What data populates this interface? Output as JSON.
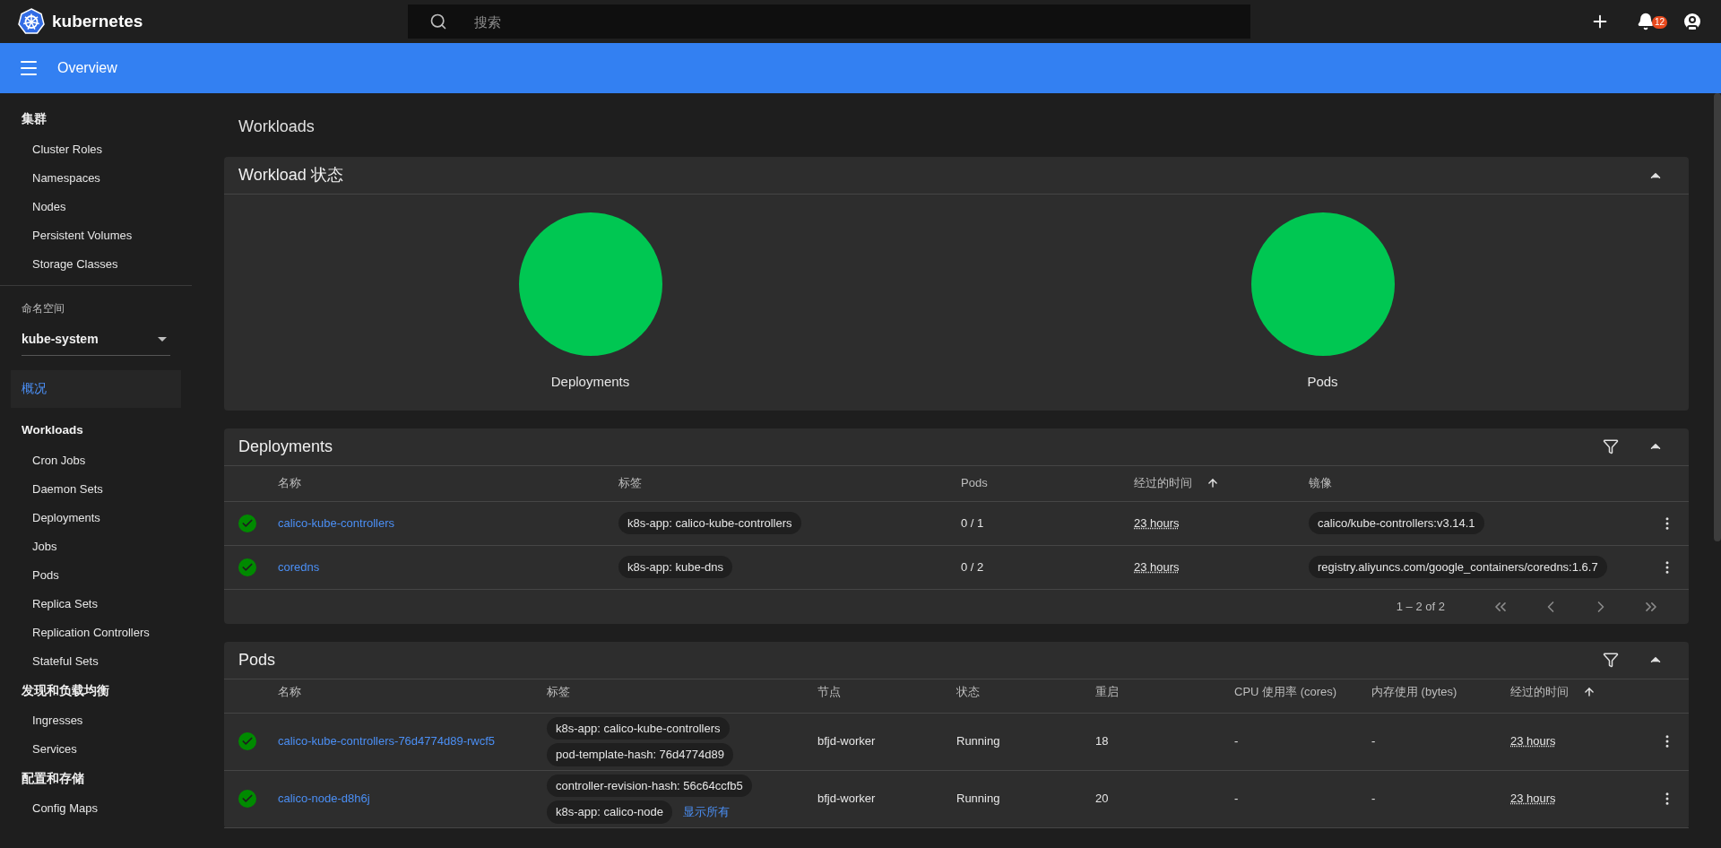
{
  "header": {
    "brand": "kubernetes",
    "search": {
      "placeholder": "搜索"
    },
    "notification_count": "12"
  },
  "toolbar": {
    "title": "Overview"
  },
  "sidebar": {
    "blocks": [
      {
        "kind": "section",
        "title": "集群",
        "items": [
          {
            "label": "Cluster Roles",
            "selected": false
          },
          {
            "label": "Namespaces",
            "selected": false
          },
          {
            "label": "Nodes",
            "selected": false
          },
          {
            "label": "Persistent Volumes",
            "selected": false
          },
          {
            "label": "Storage Classes",
            "selected": false
          }
        ]
      },
      {
        "kind": "namespace",
        "label": "命名空间",
        "value": "kube-system"
      },
      {
        "kind": "link",
        "label": "概况",
        "selected": true
      },
      {
        "kind": "section",
        "title": "Workloads",
        "items": [
          {
            "label": "Cron Jobs",
            "selected": false
          },
          {
            "label": "Daemon Sets",
            "selected": false
          },
          {
            "label": "Deployments",
            "selected": false
          },
          {
            "label": "Jobs",
            "selected": false
          },
          {
            "label": "Pods",
            "selected": false
          },
          {
            "label": "Replica Sets",
            "selected": false
          },
          {
            "label": "Replication Controllers",
            "selected": false
          },
          {
            "label": "Stateful Sets",
            "selected": false
          }
        ]
      },
      {
        "kind": "section",
        "title": "发现和负载均衡",
        "items": [
          {
            "label": "Ingresses",
            "selected": false
          },
          {
            "label": "Services",
            "selected": false
          }
        ]
      },
      {
        "kind": "section",
        "title": "配置和存储",
        "items": [
          {
            "label": "Config Maps",
            "selected": false
          }
        ]
      }
    ]
  },
  "page_title": "Workloads",
  "status_card": {
    "title": "Workload 状态",
    "charts": [
      {
        "label": "Deployments"
      },
      {
        "label": "Pods"
      }
    ]
  },
  "deployments": {
    "title": "Deployments",
    "columns": [
      {
        "label": "名称",
        "sorted": false
      },
      {
        "label": "标签",
        "sorted": false
      },
      {
        "label": "Pods",
        "sorted": false
      },
      {
        "label": "经过的时间",
        "sorted": true
      },
      {
        "label": "镜像",
        "sorted": false
      }
    ],
    "rows": [
      {
        "healthy": true,
        "name": "calico-kube-controllers",
        "labels": [
          "k8s-app: calico-kube-controllers"
        ],
        "pods": "0 / 1",
        "age": "23 hours",
        "images": [
          "calico/kube-controllers:v3.14.1"
        ]
      },
      {
        "healthy": true,
        "name": "coredns",
        "labels": [
          "k8s-app: kube-dns"
        ],
        "pods": "0 / 2",
        "age": "23 hours",
        "images": [
          "registry.aliyuncs.com/google_containers/coredns:1.6.7"
        ]
      }
    ],
    "pagination": "1 – 2 of 2"
  },
  "pods": {
    "title": "Pods",
    "columns": [
      {
        "label": "名称",
        "sorted": false
      },
      {
        "label": "标签",
        "sorted": false
      },
      {
        "label": "节点",
        "sorted": false
      },
      {
        "label": "状态",
        "sorted": false
      },
      {
        "label": "重启",
        "sorted": false
      },
      {
        "label": "CPU 使用率 (cores)",
        "sorted": false
      },
      {
        "label": "内存使用 (bytes)",
        "sorted": false
      },
      {
        "label": "经过的时间",
        "sorted": true
      }
    ],
    "rows": [
      {
        "healthy": true,
        "name": "calico-kube-controllers-76d4774d89-rwcf5",
        "labels": [
          "k8s-app: calico-kube-controllers",
          "pod-template-hash: 76d4774d89"
        ],
        "node": "bfjd-worker",
        "status": "Running",
        "restarts": "18",
        "cpu": "-",
        "memory": "-",
        "age": "23 hours"
      },
      {
        "healthy": true,
        "name": "calico-node-d8h6j",
        "labels": [
          "controller-revision-hash: 56c64ccfb5",
          "k8s-app: calico-node"
        ],
        "more_link": "显示所有",
        "node": "bfjd-worker",
        "status": "Running",
        "restarts": "20",
        "cpu": "-",
        "memory": "-",
        "age": "23 hours"
      }
    ]
  }
}
